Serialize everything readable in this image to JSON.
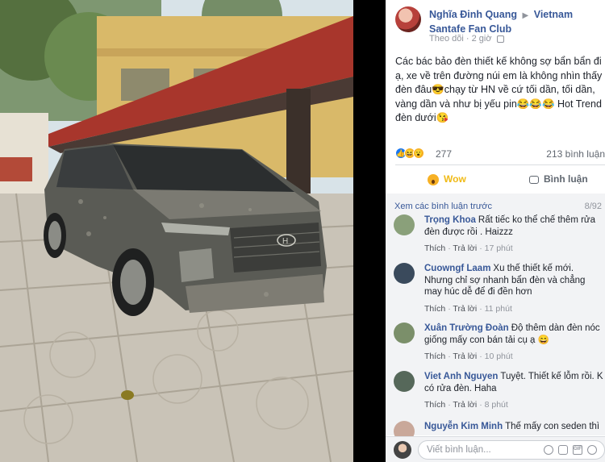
{
  "post": {
    "author": "Nghĩa Đinh Quang",
    "arrow": "▶",
    "group": "Vietnam Santafe Fan Club",
    "follow_label": "Theo dõi",
    "dot": "·",
    "time": "2 giờ",
    "text": "Các bác bảo đèn thiết kế không sợ bẩn bẩn đi ạ, xe về trên đường núi em là không nhìn thấy đèn đâu😎chạy từ HN về cứ tối dần, tối dần, vàng dần và như bị yếu pin😂😂😂 Hot Trend đèn dưới😘"
  },
  "reactions": {
    "icons": [
      "like-icon",
      "haha-icon",
      "wow-icon"
    ],
    "like_glyph": "👍",
    "haha_glyph": "😆",
    "wow_glyph": "😮",
    "count": "277",
    "comment_count": "213 bình luận"
  },
  "actions": {
    "wow_label": "Wow",
    "comment_label": "Bình luận"
  },
  "comments_section": {
    "prev_link": "Xem các bình luận trước",
    "prev_count": "8/92",
    "like_label": "Thích",
    "dot": "·",
    "reply_label": "Trả lời",
    "items": [
      {
        "name": "Trọng Khoa",
        "text": "Rất tiếc ko thể chế thêm rửa đèn được rồi . Haizzz",
        "time": "17 phút",
        "avatar_color": "#8aa07a"
      },
      {
        "name": "Cuowngf Laam",
        "text": "Xu thế thiết kế mới. Nhưng chỉ sợ nhanh bẩn đèn và chẳng may húc dễ để đi đền hơn",
        "time": "11 phút",
        "avatar_color": "#3a4a5c"
      },
      {
        "name": "Xuân Trường Đoàn",
        "text": "Độ thêm dàn đèn nóc giống mấy con bán tải cụ ạ 😄",
        "time": "10 phút",
        "avatar_color": "#7b8f6a"
      },
      {
        "name": "Viet Anh Nguyen",
        "text": "Tuyệt. Thiết kế lỗm rồi. K có rửa đèn. Haha",
        "time": "8 phút",
        "avatar_color": "#56685a"
      },
      {
        "name": "Nguyễn Kim Minh",
        "text": "Thế mấy con seden thì",
        "time": "",
        "avatar_color": "#c9a89a"
      }
    ]
  },
  "composer": {
    "placeholder": "Viết bình luận...",
    "icons": [
      "emoji-icon",
      "camera-icon",
      "gif-icon",
      "sticker-icon"
    ],
    "gif_label": "GIF"
  },
  "photo": {
    "badge_text": "H"
  }
}
